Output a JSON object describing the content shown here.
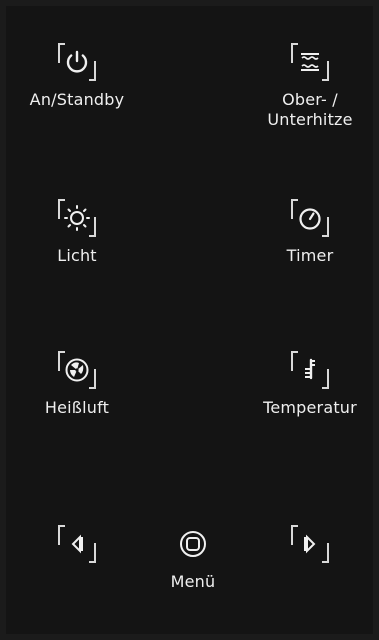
{
  "controls": {
    "power": {
      "label": "An/Standby",
      "icon": "power-icon"
    },
    "heat": {
      "label": "Ober- /\nUnterhitze",
      "icon": "top-bottom-heat-icon"
    },
    "light": {
      "label": "Licht",
      "icon": "light-icon"
    },
    "timer": {
      "label": "Timer",
      "icon": "timer-icon"
    },
    "fan": {
      "label": "Heißluft",
      "icon": "fan-icon"
    },
    "temp": {
      "label": "Temperatur",
      "icon": "thermometer-icon"
    },
    "left": {
      "label": "",
      "icon": "arrow-left-icon"
    },
    "menu": {
      "label": "Menü",
      "icon": "menu-icon"
    },
    "right": {
      "label": "",
      "icon": "arrow-right-icon"
    }
  }
}
